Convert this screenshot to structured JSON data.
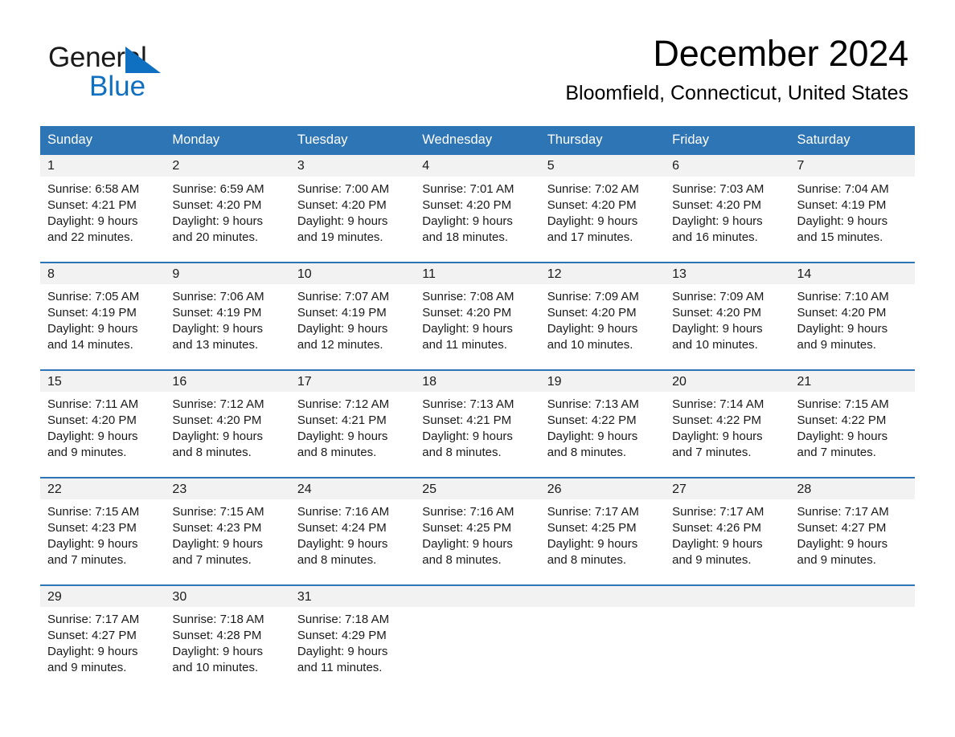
{
  "brand": {
    "word1": "General",
    "word2": "Blue",
    "triangle_color": "#0f6fc0",
    "text_color": "#1a1a1a"
  },
  "header": {
    "month_title": "December 2024",
    "location": "Bloomfield, Connecticut, United States"
  },
  "theme": {
    "header_blue": "#2e75b6",
    "date_band_gray": "#f2f2f2",
    "text": "#1a1a1a",
    "white": "#ffffff"
  },
  "weekday_headers": [
    "Sunday",
    "Monday",
    "Tuesday",
    "Wednesday",
    "Thursday",
    "Friday",
    "Saturday"
  ],
  "weeks": [
    {
      "dates": [
        "1",
        "2",
        "3",
        "4",
        "5",
        "6",
        "7"
      ],
      "cells": [
        {
          "sunrise": "Sunrise: 6:58 AM",
          "sunset": "Sunset: 4:21 PM",
          "daylight1": "Daylight: 9 hours",
          "daylight2": "and 22 minutes."
        },
        {
          "sunrise": "Sunrise: 6:59 AM",
          "sunset": "Sunset: 4:20 PM",
          "daylight1": "Daylight: 9 hours",
          "daylight2": "and 20 minutes."
        },
        {
          "sunrise": "Sunrise: 7:00 AM",
          "sunset": "Sunset: 4:20 PM",
          "daylight1": "Daylight: 9 hours",
          "daylight2": "and 19 minutes."
        },
        {
          "sunrise": "Sunrise: 7:01 AM",
          "sunset": "Sunset: 4:20 PM",
          "daylight1": "Daylight: 9 hours",
          "daylight2": "and 18 minutes."
        },
        {
          "sunrise": "Sunrise: 7:02 AM",
          "sunset": "Sunset: 4:20 PM",
          "daylight1": "Daylight: 9 hours",
          "daylight2": "and 17 minutes."
        },
        {
          "sunrise": "Sunrise: 7:03 AM",
          "sunset": "Sunset: 4:20 PM",
          "daylight1": "Daylight: 9 hours",
          "daylight2": "and 16 minutes."
        },
        {
          "sunrise": "Sunrise: 7:04 AM",
          "sunset": "Sunset: 4:19 PM",
          "daylight1": "Daylight: 9 hours",
          "daylight2": "and 15 minutes."
        }
      ]
    },
    {
      "dates": [
        "8",
        "9",
        "10",
        "11",
        "12",
        "13",
        "14"
      ],
      "cells": [
        {
          "sunrise": "Sunrise: 7:05 AM",
          "sunset": "Sunset: 4:19 PM",
          "daylight1": "Daylight: 9 hours",
          "daylight2": "and 14 minutes."
        },
        {
          "sunrise": "Sunrise: 7:06 AM",
          "sunset": "Sunset: 4:19 PM",
          "daylight1": "Daylight: 9 hours",
          "daylight2": "and 13 minutes."
        },
        {
          "sunrise": "Sunrise: 7:07 AM",
          "sunset": "Sunset: 4:19 PM",
          "daylight1": "Daylight: 9 hours",
          "daylight2": "and 12 minutes."
        },
        {
          "sunrise": "Sunrise: 7:08 AM",
          "sunset": "Sunset: 4:20 PM",
          "daylight1": "Daylight: 9 hours",
          "daylight2": "and 11 minutes."
        },
        {
          "sunrise": "Sunrise: 7:09 AM",
          "sunset": "Sunset: 4:20 PM",
          "daylight1": "Daylight: 9 hours",
          "daylight2": "and 10 minutes."
        },
        {
          "sunrise": "Sunrise: 7:09 AM",
          "sunset": "Sunset: 4:20 PM",
          "daylight1": "Daylight: 9 hours",
          "daylight2": "and 10 minutes."
        },
        {
          "sunrise": "Sunrise: 7:10 AM",
          "sunset": "Sunset: 4:20 PM",
          "daylight1": "Daylight: 9 hours",
          "daylight2": "and 9 minutes."
        }
      ]
    },
    {
      "dates": [
        "15",
        "16",
        "17",
        "18",
        "19",
        "20",
        "21"
      ],
      "cells": [
        {
          "sunrise": "Sunrise: 7:11 AM",
          "sunset": "Sunset: 4:20 PM",
          "daylight1": "Daylight: 9 hours",
          "daylight2": "and 9 minutes."
        },
        {
          "sunrise": "Sunrise: 7:12 AM",
          "sunset": "Sunset: 4:20 PM",
          "daylight1": "Daylight: 9 hours",
          "daylight2": "and 8 minutes."
        },
        {
          "sunrise": "Sunrise: 7:12 AM",
          "sunset": "Sunset: 4:21 PM",
          "daylight1": "Daylight: 9 hours",
          "daylight2": "and 8 minutes."
        },
        {
          "sunrise": "Sunrise: 7:13 AM",
          "sunset": "Sunset: 4:21 PM",
          "daylight1": "Daylight: 9 hours",
          "daylight2": "and 8 minutes."
        },
        {
          "sunrise": "Sunrise: 7:13 AM",
          "sunset": "Sunset: 4:22 PM",
          "daylight1": "Daylight: 9 hours",
          "daylight2": "and 8 minutes."
        },
        {
          "sunrise": "Sunrise: 7:14 AM",
          "sunset": "Sunset: 4:22 PM",
          "daylight1": "Daylight: 9 hours",
          "daylight2": "and 7 minutes."
        },
        {
          "sunrise": "Sunrise: 7:15 AM",
          "sunset": "Sunset: 4:22 PM",
          "daylight1": "Daylight: 9 hours",
          "daylight2": "and 7 minutes."
        }
      ]
    },
    {
      "dates": [
        "22",
        "23",
        "24",
        "25",
        "26",
        "27",
        "28"
      ],
      "cells": [
        {
          "sunrise": "Sunrise: 7:15 AM",
          "sunset": "Sunset: 4:23 PM",
          "daylight1": "Daylight: 9 hours",
          "daylight2": "and 7 minutes."
        },
        {
          "sunrise": "Sunrise: 7:15 AM",
          "sunset": "Sunset: 4:23 PM",
          "daylight1": "Daylight: 9 hours",
          "daylight2": "and 7 minutes."
        },
        {
          "sunrise": "Sunrise: 7:16 AM",
          "sunset": "Sunset: 4:24 PM",
          "daylight1": "Daylight: 9 hours",
          "daylight2": "and 8 minutes."
        },
        {
          "sunrise": "Sunrise: 7:16 AM",
          "sunset": "Sunset: 4:25 PM",
          "daylight1": "Daylight: 9 hours",
          "daylight2": "and 8 minutes."
        },
        {
          "sunrise": "Sunrise: 7:17 AM",
          "sunset": "Sunset: 4:25 PM",
          "daylight1": "Daylight: 9 hours",
          "daylight2": "and 8 minutes."
        },
        {
          "sunrise": "Sunrise: 7:17 AM",
          "sunset": "Sunset: 4:26 PM",
          "daylight1": "Daylight: 9 hours",
          "daylight2": "and 9 minutes."
        },
        {
          "sunrise": "Sunrise: 7:17 AM",
          "sunset": "Sunset: 4:27 PM",
          "daylight1": "Daylight: 9 hours",
          "daylight2": "and 9 minutes."
        }
      ]
    },
    {
      "dates": [
        "29",
        "30",
        "31",
        "",
        "",
        "",
        ""
      ],
      "cells": [
        {
          "sunrise": "Sunrise: 7:17 AM",
          "sunset": "Sunset: 4:27 PM",
          "daylight1": "Daylight: 9 hours",
          "daylight2": "and 9 minutes."
        },
        {
          "sunrise": "Sunrise: 7:18 AM",
          "sunset": "Sunset: 4:28 PM",
          "daylight1": "Daylight: 9 hours",
          "daylight2": "and 10 minutes."
        },
        {
          "sunrise": "Sunrise: 7:18 AM",
          "sunset": "Sunset: 4:29 PM",
          "daylight1": "Daylight: 9 hours",
          "daylight2": "and 11 minutes."
        },
        {
          "sunrise": "",
          "sunset": "",
          "daylight1": "",
          "daylight2": ""
        },
        {
          "sunrise": "",
          "sunset": "",
          "daylight1": "",
          "daylight2": ""
        },
        {
          "sunrise": "",
          "sunset": "",
          "daylight1": "",
          "daylight2": ""
        },
        {
          "sunrise": "",
          "sunset": "",
          "daylight1": "",
          "daylight2": ""
        }
      ]
    }
  ]
}
